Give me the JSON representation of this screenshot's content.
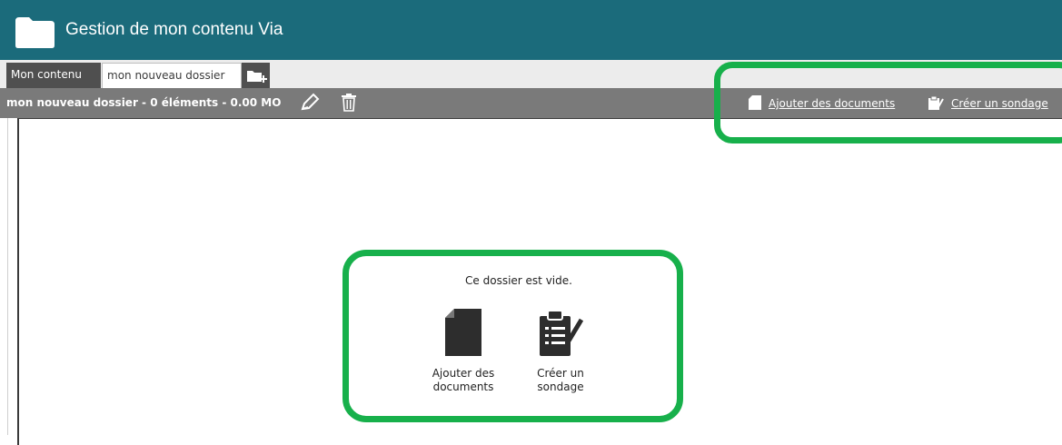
{
  "header": {
    "title": "Gestion de mon contenu Via",
    "icon": "folder-icon"
  },
  "tabs": [
    {
      "label": "Mon contenu"
    },
    {
      "label": "mon nouveau dossier"
    }
  ],
  "new_folder_tab": {
    "icon": "new-folder-icon"
  },
  "toolbar": {
    "folder_info": "mon nouveau dossier - 0 éléments - 0.00 MO",
    "edit_icon": "pencil-icon",
    "delete_icon": "trash-icon",
    "add_documents": "Ajouter des documents",
    "create_poll": "Créer un sondage"
  },
  "empty_state": {
    "message": "Ce dossier est vide.",
    "add_documents": "Ajouter des\ndocuments",
    "create_poll": "Créer un\nsondage"
  },
  "colors": {
    "header_bg": "#1b6b7b",
    "toolbar_bg": "#7a7a7a",
    "tab_dark": "#4f4f4f",
    "highlight": "#17b04b"
  }
}
